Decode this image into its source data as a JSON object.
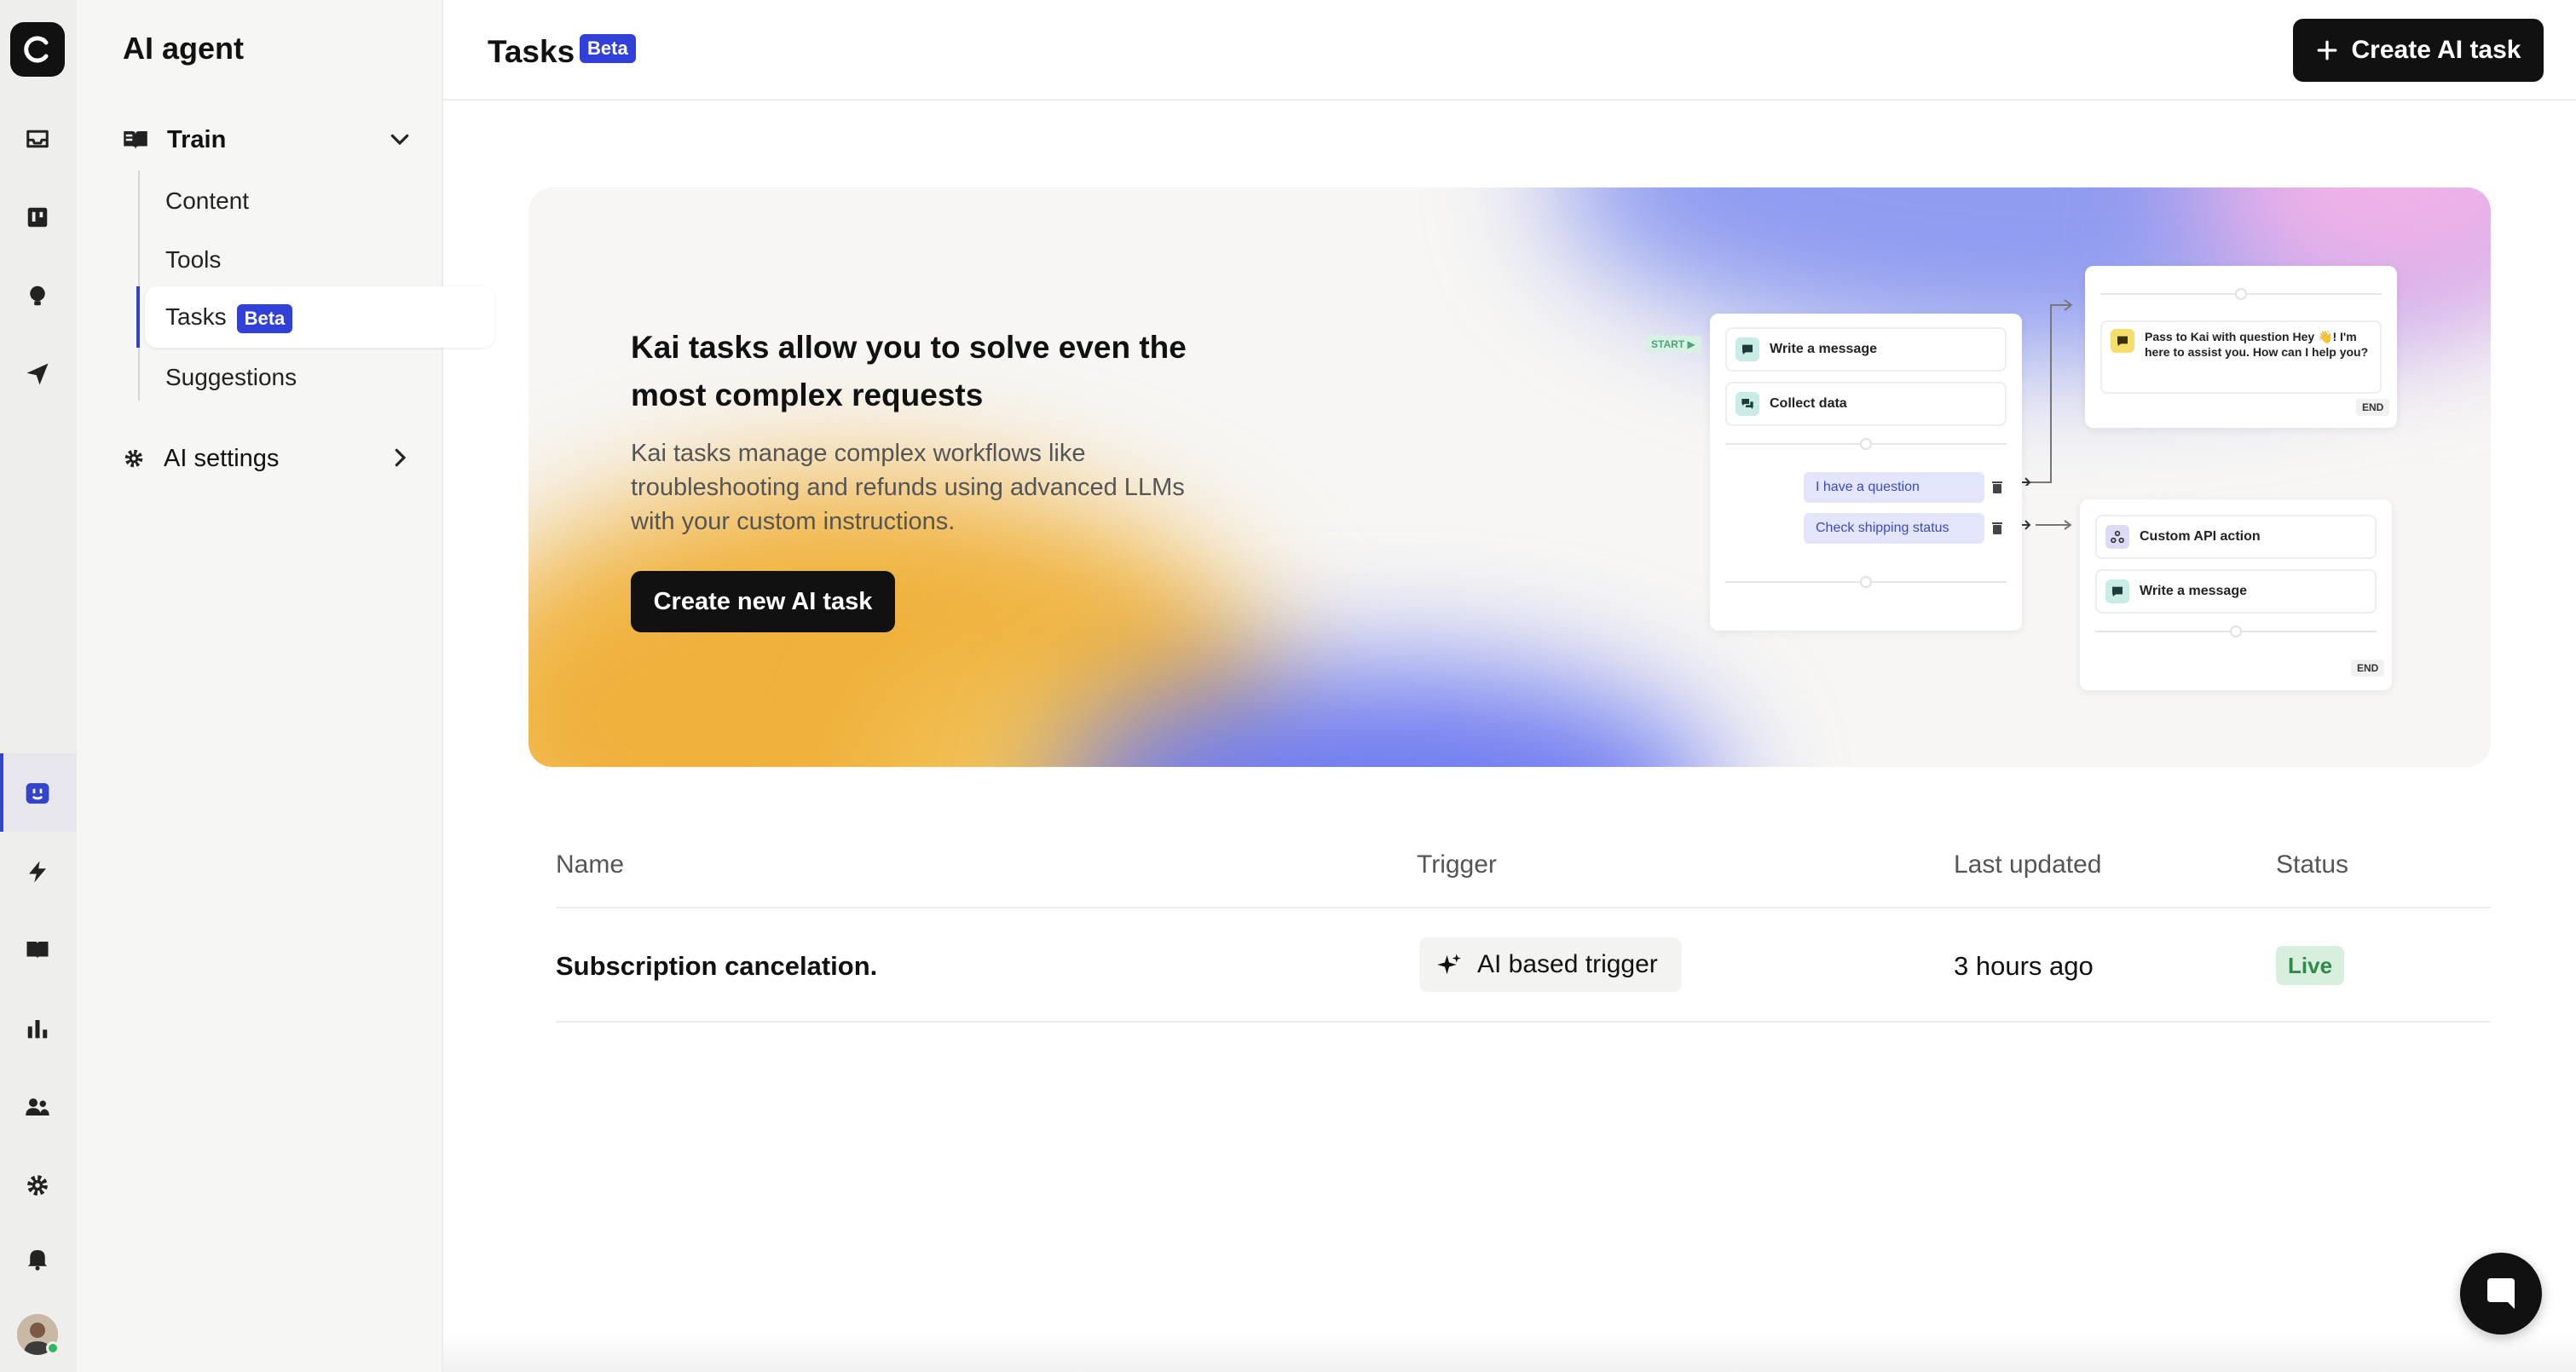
{
  "sidebar": {
    "title": "AI agent",
    "train_label": "Train",
    "items": [
      {
        "label": "Content"
      },
      {
        "label": "Tools"
      },
      {
        "label": "Tasks",
        "badge": "Beta"
      },
      {
        "label": "Suggestions"
      }
    ],
    "ai_settings_label": "AI settings"
  },
  "rail": {
    "icons": [
      "logo-icon",
      "inbox-icon",
      "kanban-icon",
      "lightbulb-icon",
      "send-icon",
      "bot-icon",
      "bolt-icon",
      "book-icon",
      "bar-chart-icon",
      "users-icon",
      "gear-icon",
      "bell-icon"
    ]
  },
  "header": {
    "title": "Tasks",
    "badge": "Beta",
    "create_button": "Create AI task"
  },
  "hero": {
    "heading": "Kai tasks allow you to solve even the most complex requests",
    "description": "Kai tasks manage complex workflows like troubleshooting and refunds using advanced LLMs with your custom instructions.",
    "button": "Create new AI task",
    "flow": {
      "start": "START ▶",
      "node_write": "Write a message",
      "node_collect": "Collect data",
      "choice_question": "I have a question",
      "choice_shipping": "Check shipping status",
      "pass_text_bold": "Pass to Kai with question",
      "pass_text": "Hey 👋! I'm here to assist you. How can I help you?",
      "node_api": "Custom API action",
      "node_write2": "Write a message",
      "end": "END"
    }
  },
  "table": {
    "columns": [
      "Name",
      "Trigger",
      "Last updated",
      "Status"
    ],
    "rows": [
      {
        "name": "Subscription cancelation.",
        "trigger": "AI based trigger",
        "updated": "3 hours ago",
        "status": "Live"
      }
    ]
  },
  "colors": {
    "accent": "#3040d8",
    "status_live_bg": "#d7efdc",
    "status_live_text": "#2f8a47"
  }
}
